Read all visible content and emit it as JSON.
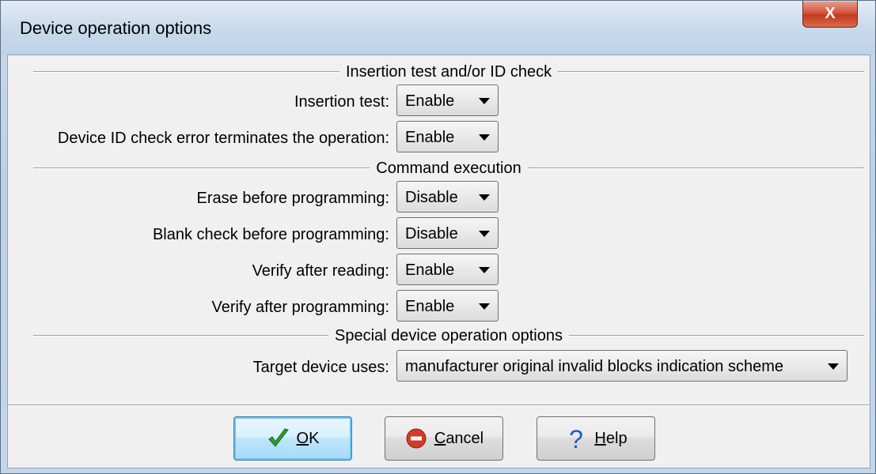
{
  "window": {
    "title": "Device operation options",
    "close_label": "X"
  },
  "groups": {
    "insertion": {
      "title": "Insertion test and/or ID check",
      "rows": [
        {
          "label": "Insertion test:",
          "value": "Enable"
        },
        {
          "label": "Device ID check error terminates the operation:",
          "value": "Enable"
        }
      ]
    },
    "command": {
      "title": "Command execution",
      "rows": [
        {
          "label": "Erase before programming:",
          "value": "Disable"
        },
        {
          "label": "Blank check before programming:",
          "value": "Disable"
        },
        {
          "label": "Verify after reading:",
          "value": "Enable"
        },
        {
          "label": "Verify after programming:",
          "value": "Enable"
        }
      ]
    },
    "special": {
      "title": "Special device operation options",
      "rows": [
        {
          "label": "Target device uses:",
          "value": "manufacturer original invalid blocks indication scheme"
        }
      ]
    }
  },
  "buttons": {
    "ok": {
      "accel": "O",
      "rest": "K",
      "icon": "checkmark-icon"
    },
    "cancel": {
      "accel": "C",
      "rest": "ancel",
      "icon": "stop-icon"
    },
    "help": {
      "accel": "H",
      "rest": "elp",
      "icon": "question-icon"
    }
  },
  "colors": {
    "dialog_bg": "#f0f0f0",
    "title_bg": "#c9daeb",
    "close_red": "#c23a1f",
    "ok_check_green": "#2e9e2e",
    "cancel_red": "#d23b2a",
    "help_blue": "#1f5fbf"
  }
}
